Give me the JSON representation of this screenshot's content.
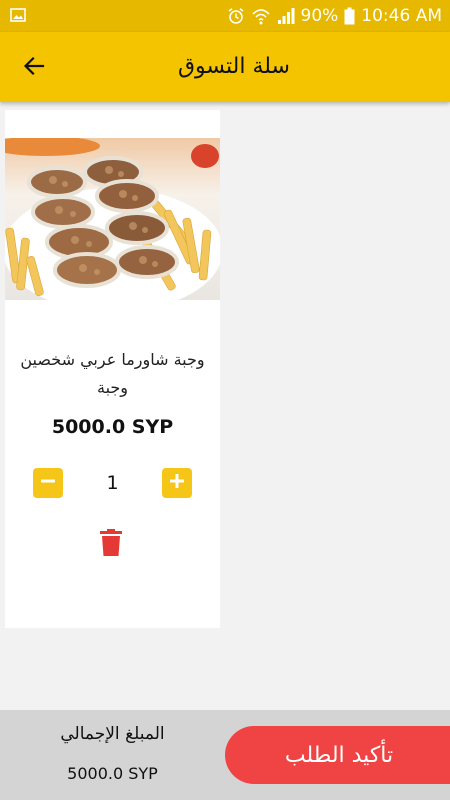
{
  "status_bar": {
    "battery_percent": "90%",
    "time": "10:46 AM",
    "icons": [
      "image-icon",
      "alarm-icon",
      "wifi-icon",
      "signal-icon",
      "battery-icon"
    ]
  },
  "app_bar": {
    "title": "سلة التسوق",
    "back_icon": "arrow-back-icon"
  },
  "cart": {
    "items": [
      {
        "name": "وجبة شاورما عربي شخصين وجبة",
        "price": "5000.0 SYP",
        "quantity": "1",
        "image": "shawarma-meal-photo"
      }
    ]
  },
  "bottom_bar": {
    "total_label": "المبلغ الإجمالي",
    "total_value": "5000.0 SYP",
    "confirm_label": "تأكيد الطلب"
  },
  "colors": {
    "app_bar": "#f4c400",
    "status_bar": "#e6b800",
    "qty_button": "#f5c518",
    "delete_icon": "#e53935",
    "confirm_button": "#f04343",
    "bottom_bar": "#d4d4d4",
    "background": "#f2f2f2"
  }
}
